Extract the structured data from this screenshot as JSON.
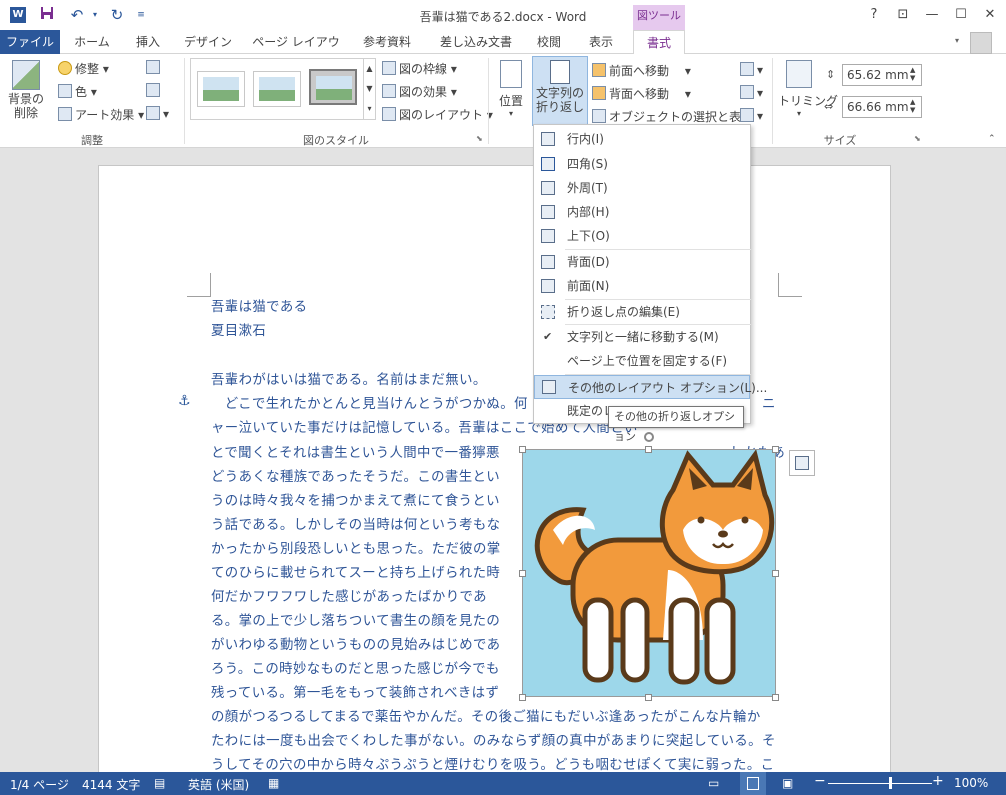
{
  "window": {
    "title": "吾輩は猫である2.docx - Word",
    "context_label": "図ツール",
    "help": "?",
    "restore_ribbon": "⊡",
    "minimize": "—",
    "maximize": "☐",
    "close": "✕"
  },
  "tabs": [
    "ファイル",
    "ホーム",
    "挿入",
    "デザイン",
    "ページ レイアウト",
    "参考資料",
    "差し込み文書",
    "校閲",
    "表示",
    "書式"
  ],
  "ribbon": {
    "adjust": {
      "remove_bg": "背景の\n削除",
      "correct": "修整",
      "color": "色",
      "art": "アート効果",
      "label": "調整"
    },
    "styles": {
      "border": "図の枠線",
      "effects": "図の効果",
      "layout": "図のレイアウト",
      "label": "図のスタイル"
    },
    "arrange": {
      "position": "位置",
      "wrap_line1": "文字列の",
      "wrap_line2": "折り返し",
      "bring_forward": "前面へ移動",
      "send_backward": "背面へ移動",
      "selection_pane": "オブジェクトの選択と表示"
    },
    "size": {
      "crop": "トリミング",
      "height": "65.62 mm",
      "width": "66.66 mm",
      "label": "サイズ"
    }
  },
  "menu": {
    "items": [
      {
        "label": "行内(I)"
      },
      {
        "label": "四角(S)"
      },
      {
        "label": "外周(T)"
      },
      {
        "label": "内部(H)"
      },
      {
        "label": "上下(O)"
      },
      {
        "label": "背面(D)"
      },
      {
        "label": "前面(N)"
      },
      {
        "label": "折り返し点の編集(E)"
      },
      {
        "label": "文字列と一緒に移動する(M)",
        "checked": true
      },
      {
        "label": "ページ上で位置を固定する(F)"
      },
      {
        "label": "その他のレイアウト オプション(L)..."
      },
      {
        "label": "既定のレ"
      }
    ],
    "check_mark": "✔",
    "tooltip": "その他の折り返しオプション"
  },
  "document": {
    "lines": [
      "吾輩は猫である",
      "夏目漱石",
      "",
      "吾輩わがはいは猫である。名前はまだ無い。",
      "　どこで生れたかとんと見当けんとうがつかぬ。何",
      "ャー泣いていた事だけは記憶している。吾輩はここで始めて人間とい",
      "とで聞くとそれは書生という人間中で一番獰悪",
      "どうあくな種族であったそうだ。この書生とい",
      "うのは時々我々を捕つかまえて煮にて食うとい",
      "う話である。しかしその当時は何という考もな",
      "かったから別段恐しいとも思った。ただ彼の掌",
      "てのひらに載せられてスーと持ち上げられた時",
      "何だかフワフワした感じがあったばかりであ",
      "る。掌の上で少し落ちついて書生の顔を見たの",
      "がいわゆる動物というものの見始みはじめであ",
      "ろう。この時妙なものだと思った感じが今でも",
      "残っている。第一毛をもって装飾されべきはず",
      "の顔がつるつるしてまるで薬缶やかんだ。その後ご猫にもだいぶ逢あったがこんな片輪か",
      "たわには一度も出会でくわした事がない。のみならず顔の真中があまりに突起している。そ",
      "うしてその穴の中から時々ぷうぷうと煙けむりを吸う。どうも咽むせぽくて実に弱った。こ"
    ],
    "line4_tail": "ニ",
    "line5_tail": "も",
    "line5_tail2": "しかもあ"
  },
  "status": {
    "page": "1/4 ページ",
    "words": "4144 文字",
    "lang": "英語 (米国)",
    "zoom": "100%",
    "minus": "−",
    "plus": "+"
  },
  "colors": {
    "accent": "#2b579a",
    "context": "#7a2e90",
    "text": "#2f5597"
  },
  "zoom_level": 0.6
}
